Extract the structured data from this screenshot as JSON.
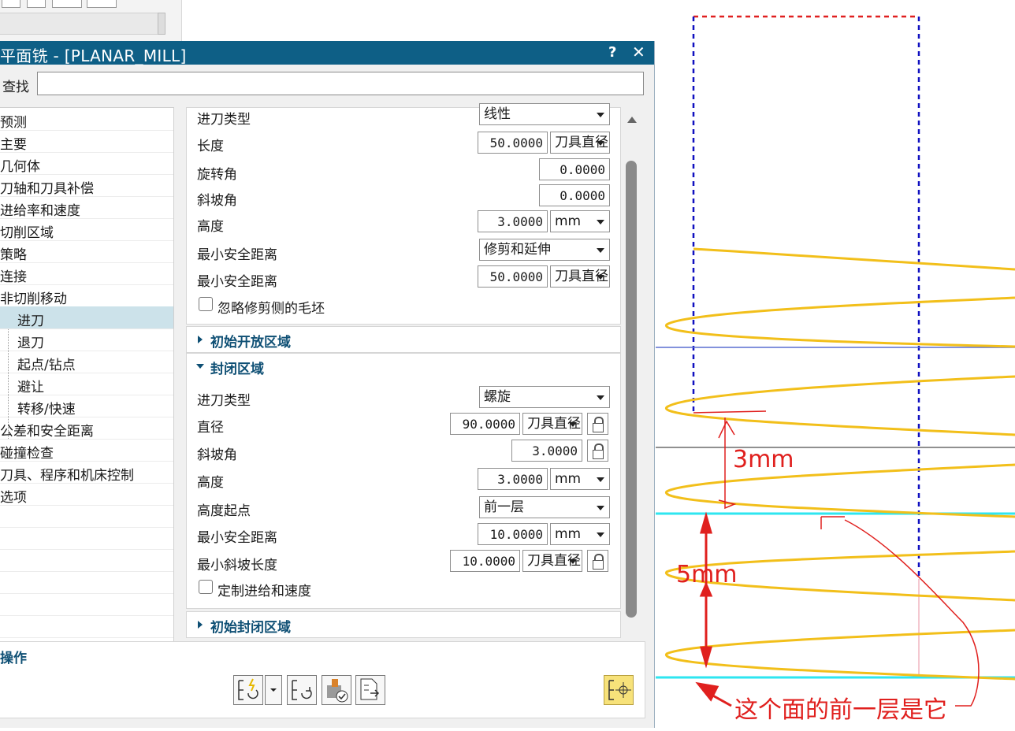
{
  "dialog": {
    "title": "平面铣 - [PLANAR_MILL]",
    "help": "?",
    "close": "✕",
    "search_label": "查找",
    "search_value": ""
  },
  "tree": [
    {
      "label": "预测",
      "indent": 0,
      "selected": false
    },
    {
      "label": "主要",
      "indent": 0,
      "selected": false
    },
    {
      "label": "几何体",
      "indent": 0,
      "selected": false
    },
    {
      "label": "刀轴和刀具补偿",
      "indent": 0,
      "selected": false
    },
    {
      "label": "进给率和速度",
      "indent": 0,
      "selected": false
    },
    {
      "label": "切削区域",
      "indent": 0,
      "selected": false
    },
    {
      "label": "策略",
      "indent": 0,
      "selected": false
    },
    {
      "label": "连接",
      "indent": 0,
      "selected": false
    },
    {
      "label": "非切削移动",
      "indent": 0,
      "selected": false
    },
    {
      "label": "进刀",
      "indent": 1,
      "selected": true
    },
    {
      "label": "退刀",
      "indent": 1,
      "selected": false
    },
    {
      "label": "起点/钻点",
      "indent": 1,
      "selected": false
    },
    {
      "label": "避让",
      "indent": 1,
      "selected": false
    },
    {
      "label": "转移/快速",
      "indent": 1,
      "selected": false
    },
    {
      "label": "公差和安全距离",
      "indent": 0,
      "selected": false
    },
    {
      "label": "碰撞检查",
      "indent": 0,
      "selected": false
    },
    {
      "label": "刀具、程序和机床控制",
      "indent": 0,
      "selected": false
    },
    {
      "label": "选项",
      "indent": 0,
      "selected": false
    }
  ],
  "open_area": {
    "entry_type_label": "进刀类型",
    "entry_type_value": "线性",
    "length_label": "长度",
    "length_value": "50.0000",
    "length_unit": "刀具直径",
    "rotation_label": "旋转角",
    "rotation_value": "0.0000",
    "ramp_angle_label": "斜坡角",
    "ramp_angle_value": "0.0000",
    "height_label": "高度",
    "height_value": "3.0000",
    "height_unit": "mm",
    "min_clear_label": "最小安全距离",
    "min_clear_mode": "修剪和延伸",
    "min_clear2_label": "最小安全距离",
    "min_clear2_value": "50.0000",
    "min_clear2_unit": "刀具直径",
    "ignore_label": "忽略修剪侧的毛坯"
  },
  "sections": {
    "initial_open": "初始开放区域",
    "closed": "封闭区域",
    "initial_closed": "初始封闭区域"
  },
  "closed_area": {
    "entry_type_label": "进刀类型",
    "entry_type_value": "螺旋",
    "diameter_label": "直径",
    "diameter_value": "90.0000",
    "diameter_unit": "刀具直径",
    "ramp_angle_label": "斜坡角",
    "ramp_angle_value": "3.0000",
    "height_label": "高度",
    "height_value": "3.0000",
    "height_unit": "mm",
    "height_from_label": "高度起点",
    "height_from_value": "前一层",
    "min_clear_label": "最小安全距离",
    "min_clear_value": "10.0000",
    "min_clear_unit": "mm",
    "min_ramp_label": "最小斜坡长度",
    "min_ramp_value": "10.0000",
    "min_ramp_unit": "刀具直径",
    "custom_feed_label": "定制进给和速度"
  },
  "operations": {
    "header": "操作",
    "buttons": [
      "generate-icon",
      "replay-icon",
      "verify-icon",
      "list-icon",
      "display-icon"
    ]
  },
  "annotations": {
    "label_3mm": "3mm",
    "label_5mm": "5mm",
    "note": "这个面的前一层是它"
  },
  "colors": {
    "title_bar": "#0e5f86",
    "toolpath": "#f2bf1a",
    "annotation": "#e0201e",
    "boundary_red": "#e02020",
    "boundary_blue": "#1010c0",
    "plane_cyan": "#2ee6f0"
  }
}
